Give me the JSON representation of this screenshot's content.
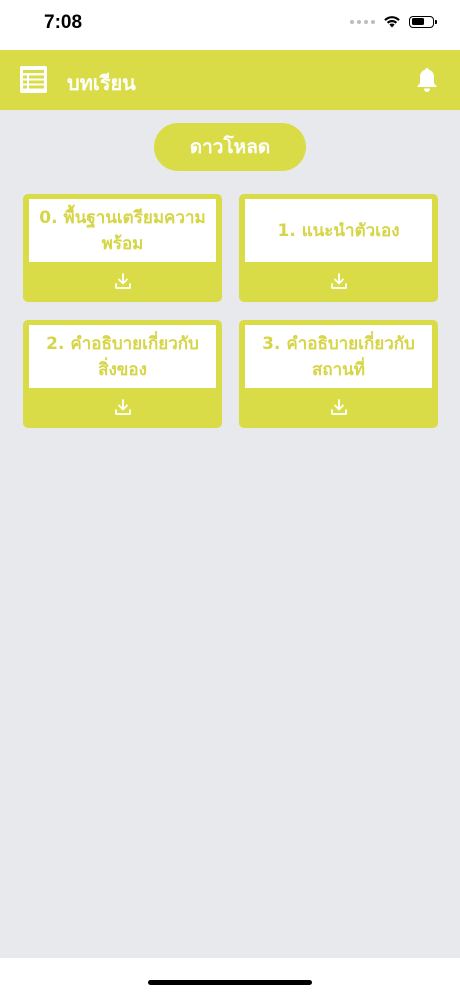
{
  "status_bar": {
    "time": "7:08",
    "battery_level": 0.6
  },
  "header": {
    "title": "บทเรียน",
    "menu_icon": "list-icon",
    "bell_icon": "bell-icon"
  },
  "download_all_label": "ดาวโหลด",
  "lessons": [
    {
      "title": "0. พื้นฐานเตรียมความพร้อม"
    },
    {
      "title": "1. แนะนำตัวเอง"
    },
    {
      "title": "2. คำอธิบายเกี่ยวกับสิ่งของ"
    },
    {
      "title": "3. คำอธิบายเกี่ยวกับสถานที่"
    }
  ],
  "colors": {
    "accent": "#d9dc47",
    "background": "#e8e9ec",
    "card_text": "#d6d547",
    "white": "#ffffff"
  }
}
